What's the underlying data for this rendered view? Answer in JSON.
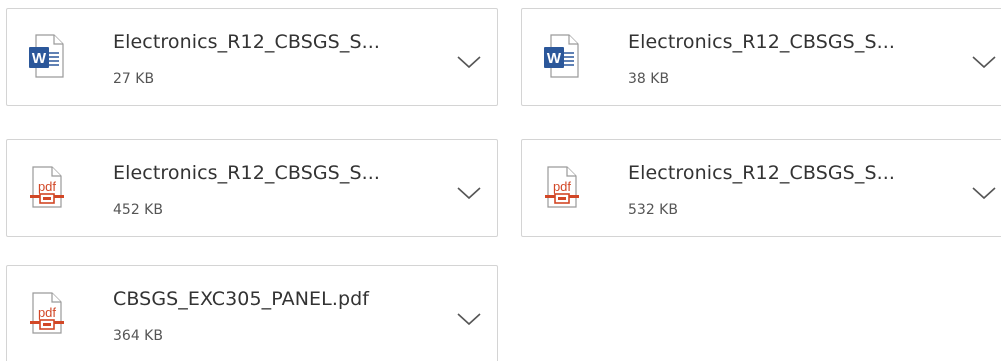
{
  "attachments": [
    {
      "name": "Electronics_R12_CBSGS_S...",
      "size": "27 KB",
      "type": "word"
    },
    {
      "name": "Electronics_R12_CBSGS_S...",
      "size": "38 KB",
      "type": "word"
    },
    {
      "name": "Electronics_R12_CBSGS_S...",
      "size": "452 KB",
      "type": "pdf"
    },
    {
      "name": "Electronics_R12_CBSGS_S...",
      "size": "532 KB",
      "type": "pdf"
    },
    {
      "name": "CBSGS_EXC305_PANEL.pdf",
      "size": "364 KB",
      "type": "pdf"
    }
  ],
  "icons": {
    "word_label": "W",
    "pdf_label": "pdf"
  },
  "colors": {
    "word_blue": "#2b579a",
    "pdf_red": "#d24726",
    "border": "#d4d4d4",
    "text": "#333333"
  }
}
